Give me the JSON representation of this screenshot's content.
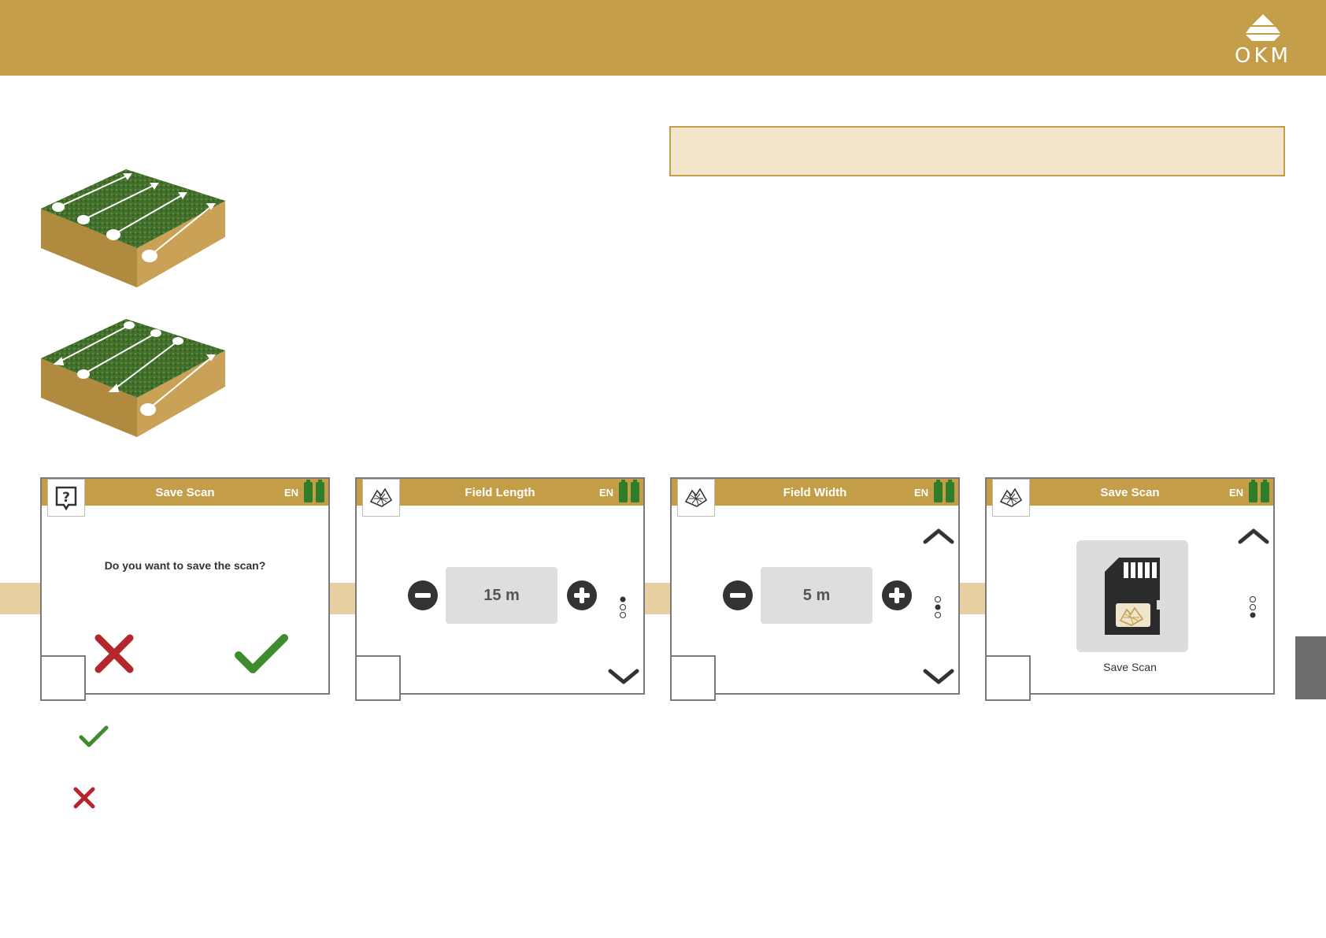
{
  "brand": {
    "logo_text": "OKM"
  },
  "screens": [
    {
      "title": "Save Scan",
      "lang": "EN",
      "question": "Do you want to save the scan?"
    },
    {
      "title": "Field Length",
      "lang": "EN",
      "value": "15 m"
    },
    {
      "title": "Field Width",
      "lang": "EN",
      "value": "5 m"
    },
    {
      "title": "Save Scan",
      "lang": "EN",
      "label": "Save Scan"
    }
  ],
  "colors": {
    "header": "#c49d48",
    "accept": "#3f8c2e",
    "reject": "#b3262b",
    "battery": "#2e7d2b"
  },
  "icons": [
    "help-icon",
    "scan-map-icon",
    "minus-icon",
    "plus-icon",
    "chevron-up-icon",
    "chevron-down-icon",
    "sd-card-icon",
    "check-icon",
    "cross-icon",
    "battery-icon"
  ]
}
